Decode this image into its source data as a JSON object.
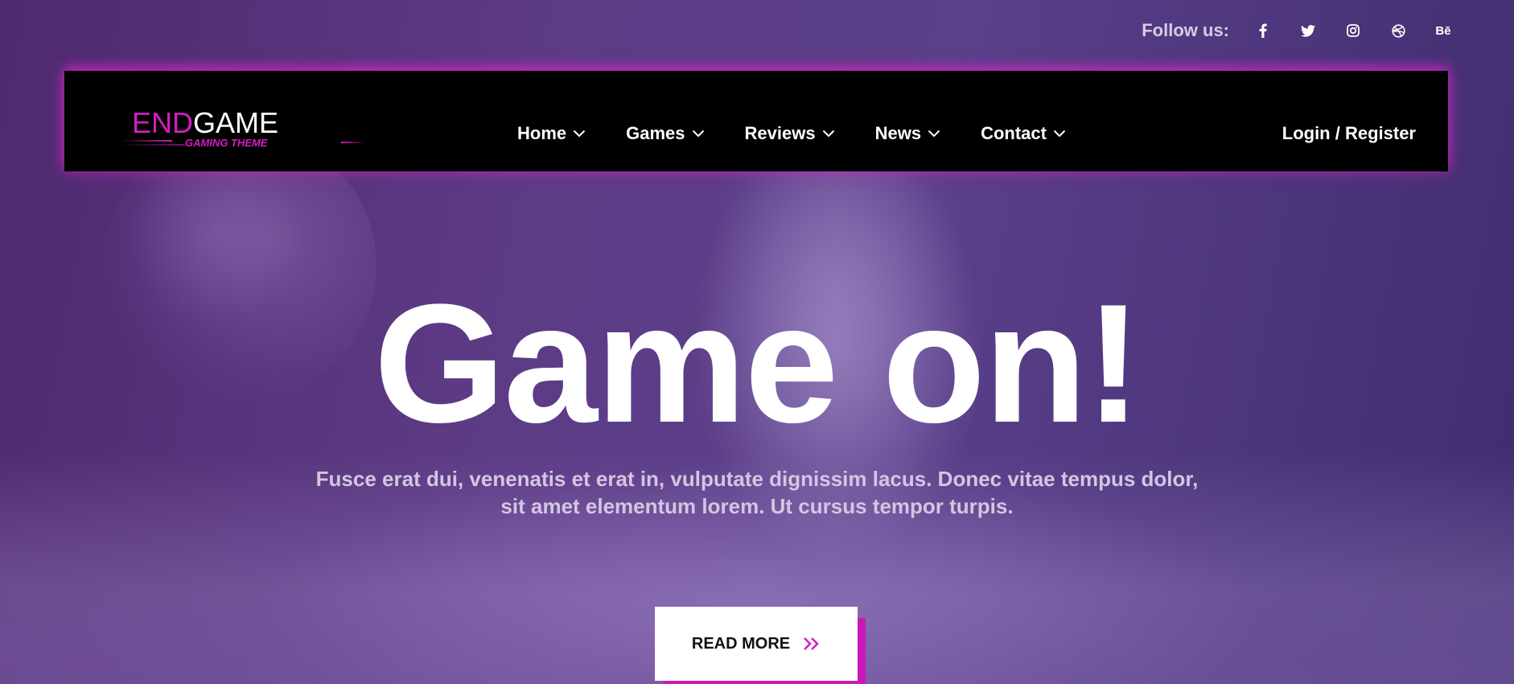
{
  "social": {
    "label": "Follow us:",
    "icons": [
      {
        "name": "facebook-icon",
        "glyph": "f"
      },
      {
        "name": "twitter-icon",
        "glyph": "twitter-bird"
      },
      {
        "name": "instagram-icon",
        "glyph": "instagram"
      },
      {
        "name": "dribbble-icon",
        "glyph": "dribbble"
      },
      {
        "name": "behance-icon",
        "glyph": "Bē"
      }
    ]
  },
  "logo": {
    "part1": "END",
    "part2": "GAME",
    "subtitle": "GAMING THEME"
  },
  "nav": {
    "items": [
      {
        "label": "Home"
      },
      {
        "label": "Games"
      },
      {
        "label": "Reviews"
      },
      {
        "label": "News"
      },
      {
        "label": "Contact"
      }
    ],
    "login": "Login / Register"
  },
  "hero": {
    "title": "Game on!",
    "text": "Fusce erat dui, venenatis et erat in, vulputate dignissim lacus. Donec vitae tempus dolor, sit amet elementum lorem. Ut cursus tempor turpis.",
    "button_label": "READ MORE"
  },
  "colors": {
    "accent": "#d21fc0",
    "navbar_bg": "#000000",
    "hero_bg": "#5a3f8a"
  }
}
